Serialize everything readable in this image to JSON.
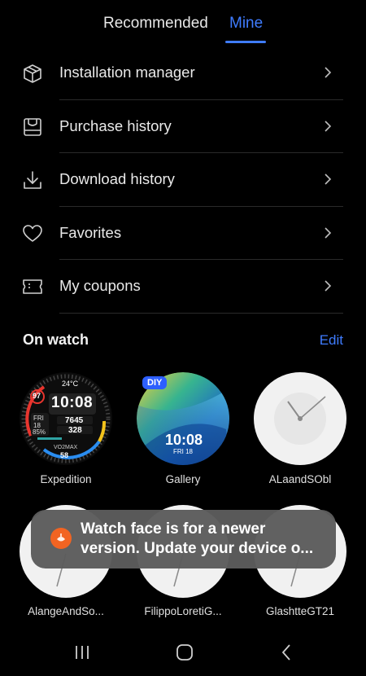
{
  "tabs": {
    "recommended": "Recommended",
    "mine": "Mine"
  },
  "menu": [
    {
      "label": "Installation manager",
      "icon": "box-download-icon"
    },
    {
      "label": "Purchase history",
      "icon": "bag-icon"
    },
    {
      "label": "Download history",
      "icon": "download-icon"
    },
    {
      "label": "Favorites",
      "icon": "heart-icon"
    },
    {
      "label": "My coupons",
      "icon": "coupon-icon"
    }
  ],
  "on_watch": {
    "title": "On watch",
    "edit": "Edit"
  },
  "faces": [
    {
      "name": "Expedition",
      "time": "10:08",
      "temp": "24°C",
      "battery": "97",
      "day": "FRI",
      "date": "18",
      "humidity": "85%",
      "steps": "7645",
      "hr": "328",
      "vo2label": "VO2MAX",
      "vo2": "58"
    },
    {
      "name": "Gallery",
      "badge": "DIY",
      "time": "10:08",
      "date": "FRI 18"
    },
    {
      "name": "ALaandSObl"
    },
    {
      "name": "AlangeAndSo..."
    },
    {
      "name": "FilippoLoretiG..."
    },
    {
      "name": "GlashtteGT21"
    }
  ],
  "toast": {
    "text": "Watch face is for a newer\nversion. Update your device o..."
  },
  "colors": {
    "accent": "#3f7cff",
    "toast_icon": "#f26422"
  }
}
